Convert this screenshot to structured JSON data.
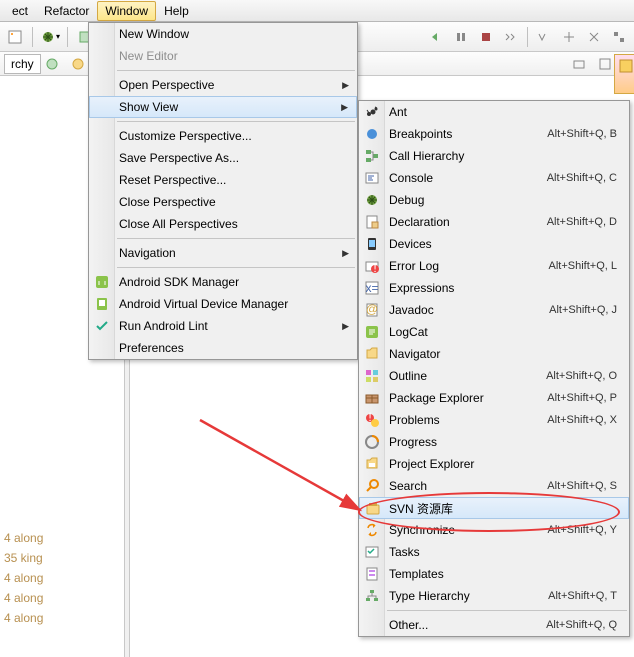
{
  "menubar": {
    "items": [
      "ect",
      "Refactor",
      "Window",
      "Help"
    ],
    "activeIndex": 2
  },
  "tab": {
    "label": "rchy"
  },
  "windowMenu": {
    "items": [
      {
        "label": "New Window",
        "type": "item"
      },
      {
        "label": "New Editor",
        "type": "item",
        "disabled": true
      },
      {
        "type": "sep"
      },
      {
        "label": "Open Perspective",
        "type": "sub"
      },
      {
        "label": "Show View",
        "type": "sub",
        "highlight": true
      },
      {
        "type": "sep"
      },
      {
        "label": "Customize Perspective...",
        "type": "item"
      },
      {
        "label": "Save Perspective As...",
        "type": "item"
      },
      {
        "label": "Reset Perspective...",
        "type": "item"
      },
      {
        "label": "Close Perspective",
        "type": "item"
      },
      {
        "label": "Close All Perspectives",
        "type": "item"
      },
      {
        "type": "sep"
      },
      {
        "label": "Navigation",
        "type": "sub"
      },
      {
        "type": "sep"
      },
      {
        "label": "Android SDK Manager",
        "type": "item",
        "icon": "android-sdk"
      },
      {
        "label": "Android Virtual Device Manager",
        "type": "item",
        "icon": "android-avd"
      },
      {
        "label": "Run Android Lint",
        "type": "sub",
        "icon": "check"
      },
      {
        "label": "Preferences",
        "type": "item"
      }
    ]
  },
  "showViewMenu": {
    "items": [
      {
        "label": "Ant",
        "icon": "ant",
        "shortcut": ""
      },
      {
        "label": "Breakpoints",
        "icon": "breakpoints",
        "shortcut": "Alt+Shift+Q, B"
      },
      {
        "label": "Call Hierarchy",
        "icon": "call-hierarchy",
        "shortcut": ""
      },
      {
        "label": "Console",
        "icon": "console",
        "shortcut": "Alt+Shift+Q, C"
      },
      {
        "label": "Debug",
        "icon": "debug",
        "shortcut": ""
      },
      {
        "label": "Declaration",
        "icon": "declaration",
        "shortcut": "Alt+Shift+Q, D"
      },
      {
        "label": "Devices",
        "icon": "devices",
        "shortcut": ""
      },
      {
        "label": "Error Log",
        "icon": "error-log",
        "shortcut": "Alt+Shift+Q, L"
      },
      {
        "label": "Expressions",
        "icon": "expressions",
        "shortcut": ""
      },
      {
        "label": "Javadoc",
        "icon": "javadoc",
        "shortcut": "Alt+Shift+Q, J"
      },
      {
        "label": "LogCat",
        "icon": "logcat",
        "shortcut": ""
      },
      {
        "label": "Navigator",
        "icon": "navigator",
        "shortcut": ""
      },
      {
        "label": "Outline",
        "icon": "outline",
        "shortcut": "Alt+Shift+Q, O"
      },
      {
        "label": "Package Explorer",
        "icon": "package-explorer",
        "shortcut": "Alt+Shift+Q, P"
      },
      {
        "label": "Problems",
        "icon": "problems",
        "shortcut": "Alt+Shift+Q, X"
      },
      {
        "label": "Progress",
        "icon": "progress",
        "shortcut": ""
      },
      {
        "label": "Project Explorer",
        "icon": "project-explorer",
        "shortcut": ""
      },
      {
        "label": "Search",
        "icon": "search",
        "shortcut": "Alt+Shift+Q, S"
      },
      {
        "label": "SVN 资源库",
        "icon": "svn",
        "shortcut": "",
        "highlight": true
      },
      {
        "label": "Synchronize",
        "icon": "synchronize",
        "shortcut": "Alt+Shift+Q, Y"
      },
      {
        "label": "Tasks",
        "icon": "tasks",
        "shortcut": ""
      },
      {
        "label": "Templates",
        "icon": "templates",
        "shortcut": ""
      },
      {
        "label": "Type Hierarchy",
        "icon": "type-hierarchy",
        "shortcut": "Alt+Shift+Q, T"
      },
      {
        "type": "sep"
      },
      {
        "label": "Other...",
        "icon": "",
        "shortcut": "Alt+Shift+Q, Q"
      }
    ]
  },
  "sidebarText": [
    "4  along",
    "35  king",
    "4  along",
    "4  along",
    "4  along"
  ],
  "watermark": ""
}
